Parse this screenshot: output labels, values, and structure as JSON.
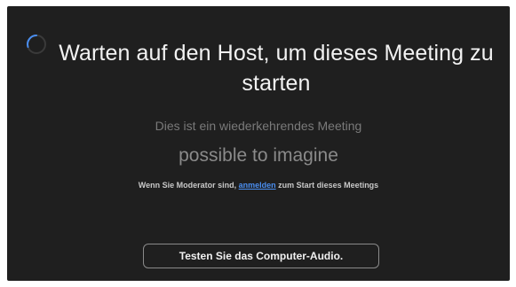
{
  "dialog": {
    "title": "Warten auf den Host, um dieses Meeting zu starten",
    "subtitle": "Dies ist ein wiederkehrendes Meeting",
    "meeting_name": "possible to imagine",
    "host_note": {
      "before": "Wenn Sie Moderator sind, ",
      "link": "anmelden",
      "after": " zum Start dieses Meetings"
    },
    "test_audio_button": "Testen Sie das Computer-Audio."
  },
  "icons": {
    "spinner": "loading-spinner-icon"
  },
  "colors": {
    "background": "#1f1f1f",
    "title_text": "#f2f2f2",
    "muted_text": "#7a7a7a",
    "link": "#4a8ef0",
    "spinner": "#4a8ef0"
  }
}
